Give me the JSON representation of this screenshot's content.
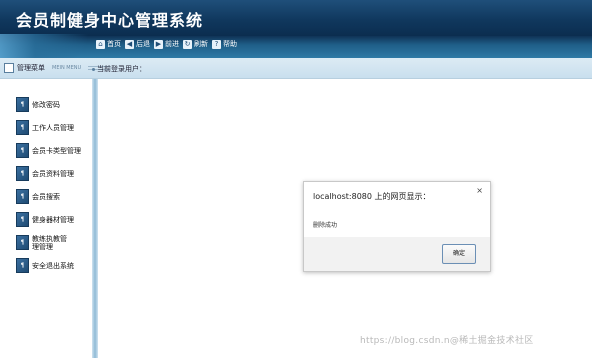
{
  "app": {
    "title": "会员制健身中心管理系统"
  },
  "toolbar": {
    "items": [
      {
        "label": "首页",
        "icon": "home-icon"
      },
      {
        "label": "后退",
        "icon": "back-arrow-icon"
      },
      {
        "label": "前进",
        "icon": "forward-arrow-icon"
      },
      {
        "label": "刷新",
        "icon": "refresh-icon"
      },
      {
        "label": "帮助",
        "icon": "help-icon"
      }
    ]
  },
  "menubar": {
    "menu_title": "管理菜单",
    "menu_title_en": "MEIN MENU",
    "current_user_label": "当前登录用户："
  },
  "sidebar": {
    "items": [
      {
        "label": "修改密码"
      },
      {
        "label": "工作人员管理"
      },
      {
        "label": "会员卡类型管理"
      },
      {
        "label": "会员资料管理"
      },
      {
        "label": "会员搜索"
      },
      {
        "label": "健身器材管理"
      },
      {
        "label": "教练执教管理管理"
      },
      {
        "label": "安全退出系统"
      }
    ]
  },
  "dialog": {
    "title": "localhost:8080 上的网页显示：",
    "close": "×",
    "message": "删除成功",
    "ok_label": "确定"
  },
  "watermark": {
    "text": "https://blog.csdn.n@稀土掘金技术社区"
  },
  "colors": {
    "header": "#10385e",
    "accent": "#2f7aa6",
    "menubar": "#c9dfee"
  }
}
